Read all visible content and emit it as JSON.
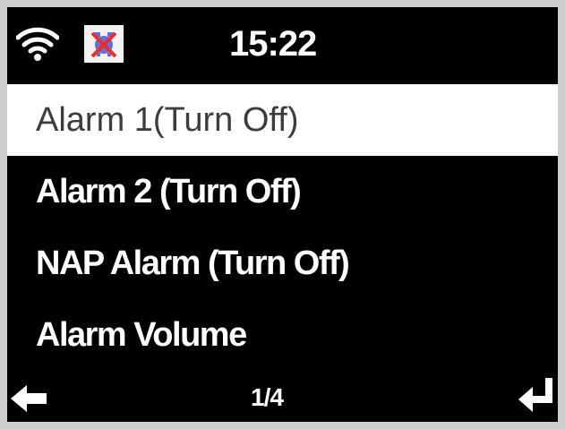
{
  "status_bar": {
    "time": "15:22",
    "wifi_icon": "wifi-icon",
    "alarm_status_icon": "alarm-off-icon"
  },
  "menu": {
    "items": [
      {
        "label": "Alarm 1(Turn Off)",
        "selected": true
      },
      {
        "label": "Alarm 2 (Turn Off)",
        "selected": false
      },
      {
        "label": "NAP Alarm (Turn Off)",
        "selected": false
      },
      {
        "label": "Alarm Volume",
        "selected": false
      }
    ]
  },
  "footer": {
    "page_indicator": "1/4",
    "back_icon": "back-arrow-icon",
    "enter_icon": "enter-icon"
  },
  "colors": {
    "screen_background": "#000000",
    "text": "#ffffff",
    "selected_background": "#ffffff",
    "selected_text": "#3c3c3c"
  }
}
